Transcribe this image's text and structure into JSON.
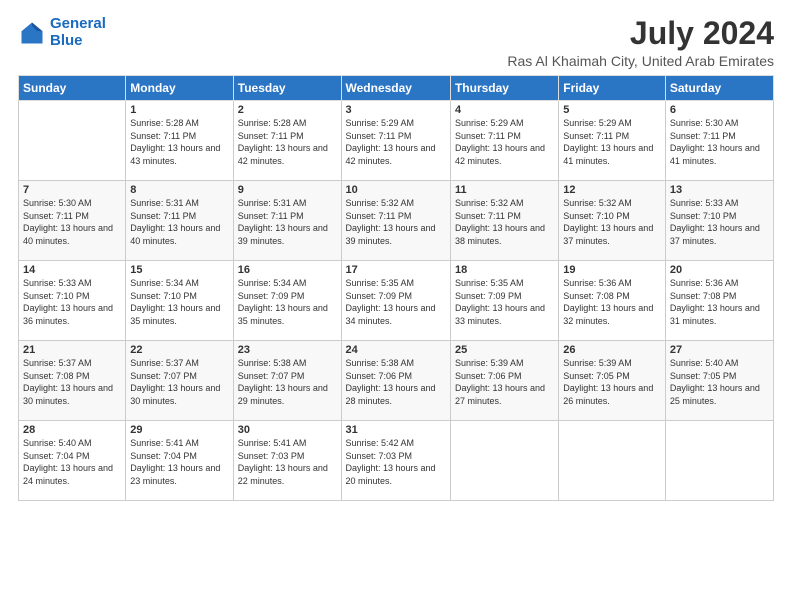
{
  "logo": {
    "line1": "General",
    "line2": "Blue"
  },
  "title": "July 2024",
  "subtitle": "Ras Al Khaimah City, United Arab Emirates",
  "days_header": [
    "Sunday",
    "Monday",
    "Tuesday",
    "Wednesday",
    "Thursday",
    "Friday",
    "Saturday"
  ],
  "weeks": [
    [
      {
        "day": "",
        "sunrise": "",
        "sunset": "",
        "daylight": ""
      },
      {
        "day": "1",
        "sunrise": "Sunrise: 5:28 AM",
        "sunset": "Sunset: 7:11 PM",
        "daylight": "Daylight: 13 hours and 43 minutes."
      },
      {
        "day": "2",
        "sunrise": "Sunrise: 5:28 AM",
        "sunset": "Sunset: 7:11 PM",
        "daylight": "Daylight: 13 hours and 42 minutes."
      },
      {
        "day": "3",
        "sunrise": "Sunrise: 5:29 AM",
        "sunset": "Sunset: 7:11 PM",
        "daylight": "Daylight: 13 hours and 42 minutes."
      },
      {
        "day": "4",
        "sunrise": "Sunrise: 5:29 AM",
        "sunset": "Sunset: 7:11 PM",
        "daylight": "Daylight: 13 hours and 42 minutes."
      },
      {
        "day": "5",
        "sunrise": "Sunrise: 5:29 AM",
        "sunset": "Sunset: 7:11 PM",
        "daylight": "Daylight: 13 hours and 41 minutes."
      },
      {
        "day": "6",
        "sunrise": "Sunrise: 5:30 AM",
        "sunset": "Sunset: 7:11 PM",
        "daylight": "Daylight: 13 hours and 41 minutes."
      }
    ],
    [
      {
        "day": "7",
        "sunrise": "Sunrise: 5:30 AM",
        "sunset": "Sunset: 7:11 PM",
        "daylight": "Daylight: 13 hours and 40 minutes."
      },
      {
        "day": "8",
        "sunrise": "Sunrise: 5:31 AM",
        "sunset": "Sunset: 7:11 PM",
        "daylight": "Daylight: 13 hours and 40 minutes."
      },
      {
        "day": "9",
        "sunrise": "Sunrise: 5:31 AM",
        "sunset": "Sunset: 7:11 PM",
        "daylight": "Daylight: 13 hours and 39 minutes."
      },
      {
        "day": "10",
        "sunrise": "Sunrise: 5:32 AM",
        "sunset": "Sunset: 7:11 PM",
        "daylight": "Daylight: 13 hours and 39 minutes."
      },
      {
        "day": "11",
        "sunrise": "Sunrise: 5:32 AM",
        "sunset": "Sunset: 7:11 PM",
        "daylight": "Daylight: 13 hours and 38 minutes."
      },
      {
        "day": "12",
        "sunrise": "Sunrise: 5:32 AM",
        "sunset": "Sunset: 7:10 PM",
        "daylight": "Daylight: 13 hours and 37 minutes."
      },
      {
        "day": "13",
        "sunrise": "Sunrise: 5:33 AM",
        "sunset": "Sunset: 7:10 PM",
        "daylight": "Daylight: 13 hours and 37 minutes."
      }
    ],
    [
      {
        "day": "14",
        "sunrise": "Sunrise: 5:33 AM",
        "sunset": "Sunset: 7:10 PM",
        "daylight": "Daylight: 13 hours and 36 minutes."
      },
      {
        "day": "15",
        "sunrise": "Sunrise: 5:34 AM",
        "sunset": "Sunset: 7:10 PM",
        "daylight": "Daylight: 13 hours and 35 minutes."
      },
      {
        "day": "16",
        "sunrise": "Sunrise: 5:34 AM",
        "sunset": "Sunset: 7:09 PM",
        "daylight": "Daylight: 13 hours and 35 minutes."
      },
      {
        "day": "17",
        "sunrise": "Sunrise: 5:35 AM",
        "sunset": "Sunset: 7:09 PM",
        "daylight": "Daylight: 13 hours and 34 minutes."
      },
      {
        "day": "18",
        "sunrise": "Sunrise: 5:35 AM",
        "sunset": "Sunset: 7:09 PM",
        "daylight": "Daylight: 13 hours and 33 minutes."
      },
      {
        "day": "19",
        "sunrise": "Sunrise: 5:36 AM",
        "sunset": "Sunset: 7:08 PM",
        "daylight": "Daylight: 13 hours and 32 minutes."
      },
      {
        "day": "20",
        "sunrise": "Sunrise: 5:36 AM",
        "sunset": "Sunset: 7:08 PM",
        "daylight": "Daylight: 13 hours and 31 minutes."
      }
    ],
    [
      {
        "day": "21",
        "sunrise": "Sunrise: 5:37 AM",
        "sunset": "Sunset: 7:08 PM",
        "daylight": "Daylight: 13 hours and 30 minutes."
      },
      {
        "day": "22",
        "sunrise": "Sunrise: 5:37 AM",
        "sunset": "Sunset: 7:07 PM",
        "daylight": "Daylight: 13 hours and 30 minutes."
      },
      {
        "day": "23",
        "sunrise": "Sunrise: 5:38 AM",
        "sunset": "Sunset: 7:07 PM",
        "daylight": "Daylight: 13 hours and 29 minutes."
      },
      {
        "day": "24",
        "sunrise": "Sunrise: 5:38 AM",
        "sunset": "Sunset: 7:06 PM",
        "daylight": "Daylight: 13 hours and 28 minutes."
      },
      {
        "day": "25",
        "sunrise": "Sunrise: 5:39 AM",
        "sunset": "Sunset: 7:06 PM",
        "daylight": "Daylight: 13 hours and 27 minutes."
      },
      {
        "day": "26",
        "sunrise": "Sunrise: 5:39 AM",
        "sunset": "Sunset: 7:05 PM",
        "daylight": "Daylight: 13 hours and 26 minutes."
      },
      {
        "day": "27",
        "sunrise": "Sunrise: 5:40 AM",
        "sunset": "Sunset: 7:05 PM",
        "daylight": "Daylight: 13 hours and 25 minutes."
      }
    ],
    [
      {
        "day": "28",
        "sunrise": "Sunrise: 5:40 AM",
        "sunset": "Sunset: 7:04 PM",
        "daylight": "Daylight: 13 hours and 24 minutes."
      },
      {
        "day": "29",
        "sunrise": "Sunrise: 5:41 AM",
        "sunset": "Sunset: 7:04 PM",
        "daylight": "Daylight: 13 hours and 23 minutes."
      },
      {
        "day": "30",
        "sunrise": "Sunrise: 5:41 AM",
        "sunset": "Sunset: 7:03 PM",
        "daylight": "Daylight: 13 hours and 22 minutes."
      },
      {
        "day": "31",
        "sunrise": "Sunrise: 5:42 AM",
        "sunset": "Sunset: 7:03 PM",
        "daylight": "Daylight: 13 hours and 20 minutes."
      },
      {
        "day": "",
        "sunrise": "",
        "sunset": "",
        "daylight": ""
      },
      {
        "day": "",
        "sunrise": "",
        "sunset": "",
        "daylight": ""
      },
      {
        "day": "",
        "sunrise": "",
        "sunset": "",
        "daylight": ""
      }
    ]
  ]
}
